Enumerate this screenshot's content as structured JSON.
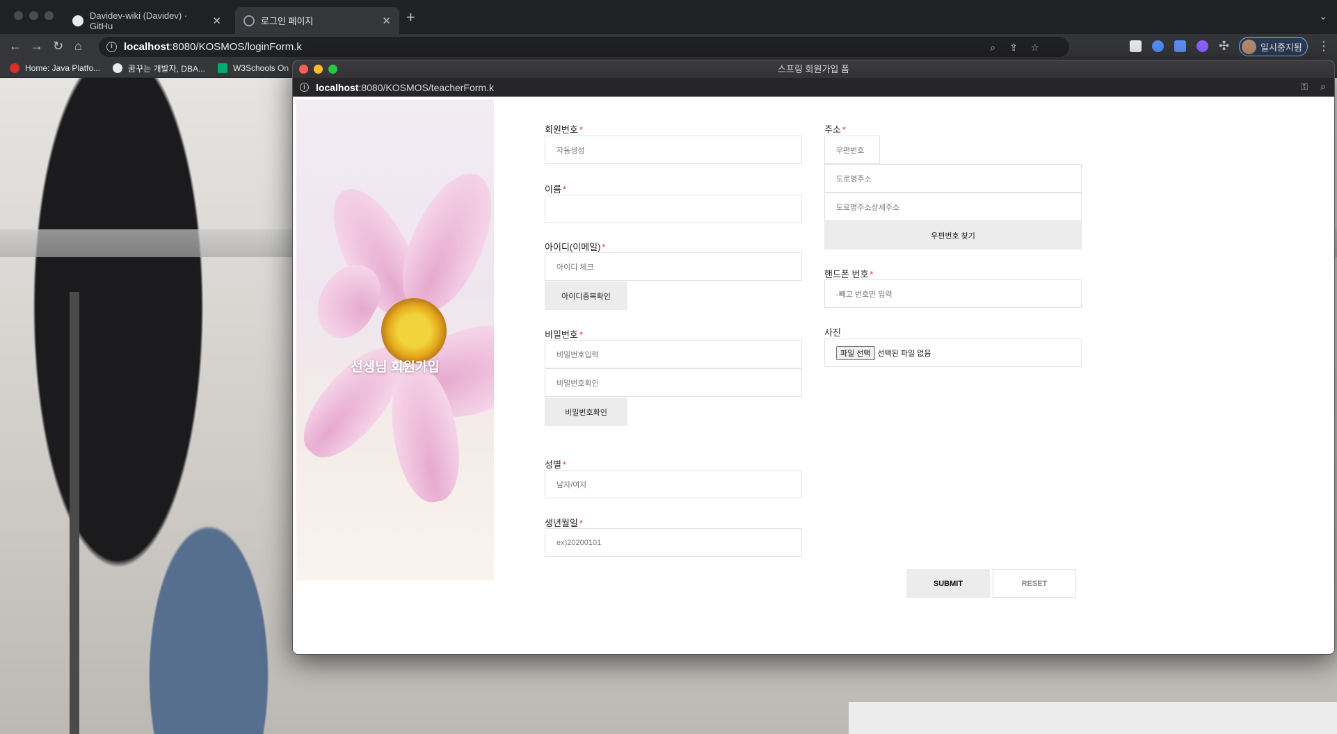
{
  "browser": {
    "tabs": [
      {
        "title": "Davidev-wiki (Davidev) · GitHu"
      },
      {
        "title": "로그인 페이지"
      }
    ],
    "url_host": "localhost",
    "url_path": ":8080/KOSMOS/loginForm.k",
    "profile_label": "일시중지됨",
    "bookmarks": [
      {
        "label": "Home: Java Platfo...",
        "icon": "oracle-icon",
        "color": "#d93025"
      },
      {
        "label": "꿈꾸는 개발자, DBA...",
        "icon": "globe-icon",
        "color": "#e8eaed"
      },
      {
        "label": "W3Schools On",
        "icon": "w3schools-icon",
        "color": "#04aa6d"
      }
    ]
  },
  "popup": {
    "window_title": "스프링 회원가입 폼",
    "url_host": "localhost",
    "url_path": ":8080/KOSMOS/teacherForm.k",
    "hero_title": "선생님 회원가입"
  },
  "form": {
    "member_no": {
      "label": "회원번호",
      "placeholder": "자동생성"
    },
    "name": {
      "label": "이름",
      "placeholder": ""
    },
    "user_id": {
      "label": "아이디(이메일)",
      "placeholder": "아이디 체크",
      "check_button": "아이디중복확인"
    },
    "password": {
      "label": "비밀번호",
      "placeholder": "비밀번호입력",
      "confirm_placeholder": "비밀번호확인",
      "confirm_button": "비밀번호확인"
    },
    "gender": {
      "label": "성별",
      "placeholder": "남자/여자"
    },
    "birth": {
      "label": "생년월일",
      "placeholder": "ex)20200101"
    },
    "address": {
      "label": "주소",
      "zip_placeholder": "우편번호",
      "road_placeholder": "도로명주소",
      "detail_placeholder": "도로명주소상세주소",
      "find_button": "우편번호 찾기"
    },
    "phone": {
      "label": "핸드폰 번호",
      "placeholder": "-빼고 번호만 입력"
    },
    "photo": {
      "label": "사진",
      "file_button": "파일 선택",
      "file_status": "선택된 파일 없음"
    },
    "required_mark": "*",
    "submit_label": "SUBMIT",
    "reset_label": "RESET"
  },
  "colors": {
    "required": "#e0343a",
    "button_bg": "#ececec"
  }
}
